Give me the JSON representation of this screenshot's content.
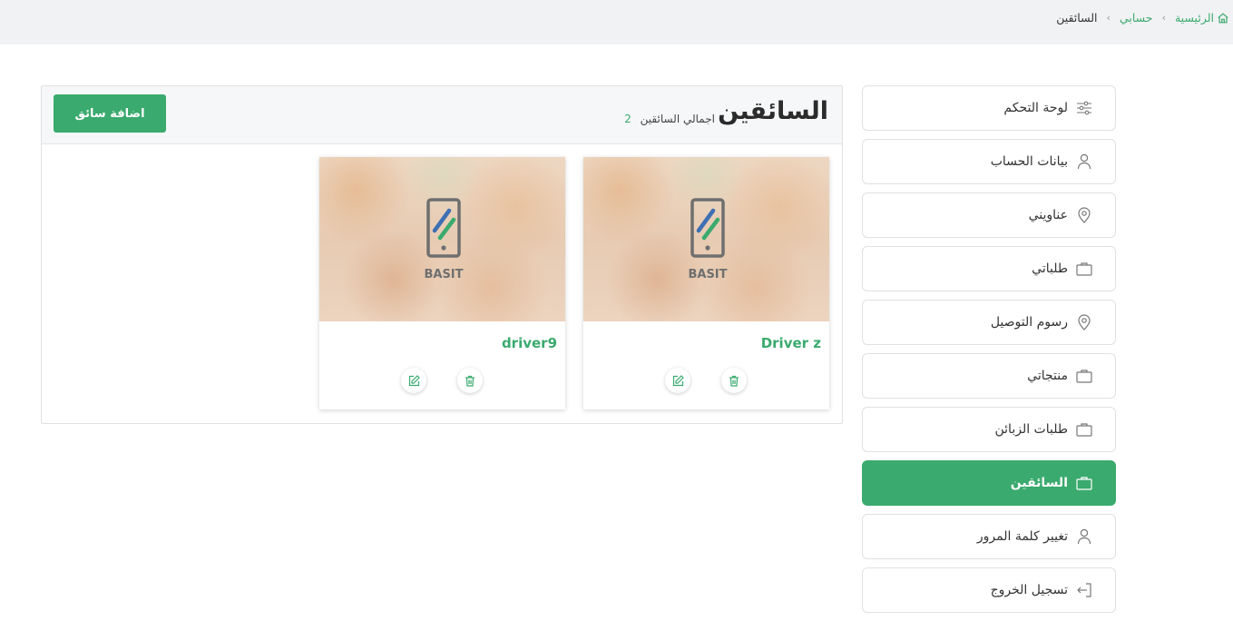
{
  "breadcrumb": {
    "home": "الرئيسية",
    "account": "حسابي",
    "current": "السائقين"
  },
  "sidebar": {
    "items": [
      {
        "label": "لوحة التحكم",
        "icon": "sliders-icon"
      },
      {
        "label": "بيانات الحساب",
        "icon": "user-icon"
      },
      {
        "label": "عناويني",
        "icon": "map-pin-icon"
      },
      {
        "label": "طلباتي",
        "icon": "bag-icon"
      },
      {
        "label": "رسوم التوصيل",
        "icon": "map-pin-icon"
      },
      {
        "label": "منتجاتي",
        "icon": "bag-icon"
      },
      {
        "label": "طلبات الزبائن",
        "icon": "bag-icon"
      },
      {
        "label": "السائقين",
        "icon": "bag-icon",
        "active": true
      },
      {
        "label": "تغيير كلمة المرور",
        "icon": "user-icon"
      },
      {
        "label": "تسجيل الخروج",
        "icon": "logout-icon"
      }
    ]
  },
  "main": {
    "title": "السائقين",
    "total_label": "اجمالي السائقين",
    "total_count": "2",
    "add_button": "اضافة سائق"
  },
  "drivers": [
    {
      "name": "Driver z"
    },
    {
      "name": "driver9"
    }
  ],
  "logo_text": "BASIT",
  "colors": {
    "accent": "#3aaa6e",
    "topbar": "#f1f2f3",
    "panel_head": "#f6f7f8"
  }
}
